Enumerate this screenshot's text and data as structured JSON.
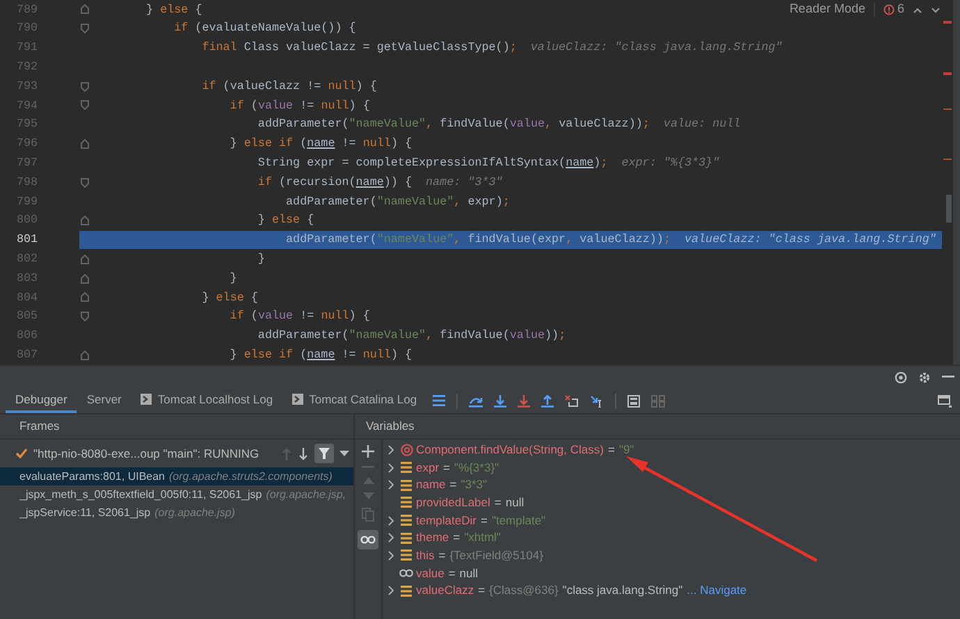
{
  "editor": {
    "reader_mode": "Reader Mode",
    "problems_count": "6",
    "lines": [
      {
        "number": "789",
        "fold": {
          "kind": "close"
        },
        "selected": false,
        "tokens": [
          {
            "t": "} ",
            "kind": "text"
          },
          {
            "t": "else",
            "kind": "keyword"
          },
          {
            "t": " {",
            "kind": "text"
          }
        ]
      },
      {
        "number": "790",
        "fold": {
          "kind": "open"
        },
        "selected": false,
        "tokens": [
          {
            "t": "    if",
            "kind": "keyword"
          },
          {
            "t": " (evaluateNameValue()) {",
            "kind": "text"
          }
        ]
      },
      {
        "number": "791",
        "selected": false,
        "tokens": [
          {
            "t": "        final",
            "kind": "keyword"
          },
          {
            "t": " Class valueClazz = getValueClassType()",
            "kind": "text"
          },
          {
            "t": ";",
            "kind": "keyword"
          }
        ],
        "hint": "valueClazz: \"class java.lang.String\""
      },
      {
        "number": "792",
        "selected": false
      },
      {
        "number": "793",
        "fold": {
          "kind": "open"
        },
        "selected": false,
        "tokens": [
          {
            "t": "        if",
            "kind": "keyword"
          },
          {
            "t": " (valueClazz != ",
            "kind": "text"
          },
          {
            "t": "null",
            "kind": "keyword"
          },
          {
            "t": ") {",
            "kind": "text"
          }
        ]
      },
      {
        "number": "794",
        "fold": {
          "kind": "open"
        },
        "selected": false,
        "tokens": [
          {
            "t": "            if",
            "kind": "keyword"
          },
          {
            "t": " (",
            "kind": "text"
          },
          {
            "t": "value",
            "kind": "field"
          },
          {
            "t": " != ",
            "kind": "text"
          },
          {
            "t": "null",
            "kind": "keyword"
          },
          {
            "t": ") {",
            "kind": "text"
          }
        ]
      },
      {
        "number": "795",
        "selected": false,
        "tokens": [
          {
            "t": "                addParameter(",
            "kind": "text"
          },
          {
            "t": "\"nameValue\"",
            "kind": "string"
          },
          {
            "t": ",",
            "kind": "keyword"
          },
          {
            "t": " findValue(",
            "kind": "text"
          },
          {
            "t": "value",
            "kind": "field"
          },
          {
            "t": ",",
            "kind": "keyword"
          },
          {
            "t": " valueClazz))",
            "kind": "text"
          },
          {
            "t": ";",
            "kind": "keyword"
          }
        ],
        "hint": "value: null"
      },
      {
        "number": "796",
        "fold": {
          "kind": "close"
        },
        "selected": false,
        "tokens": [
          {
            "t": "            } ",
            "kind": "text"
          },
          {
            "t": "else if",
            "kind": "keyword"
          },
          {
            "t": " (",
            "kind": "text"
          },
          {
            "t": "name",
            "kind": "param"
          },
          {
            "t": " != ",
            "kind": "text"
          },
          {
            "t": "null",
            "kind": "keyword"
          },
          {
            "t": ") {",
            "kind": "text"
          }
        ]
      },
      {
        "number": "797",
        "selected": false,
        "tokens": [
          {
            "t": "                String expr = completeExpressionIfAltSyntax(",
            "kind": "text"
          },
          {
            "t": "name",
            "kind": "param"
          },
          {
            "t": ")",
            "kind": "text"
          },
          {
            "t": ";",
            "kind": "keyword"
          }
        ],
        "hint": "expr: \"%{3*3}\""
      },
      {
        "number": "798",
        "fold": {
          "kind": "open"
        },
        "selected": false,
        "tokens": [
          {
            "t": "                if",
            "kind": "keyword"
          },
          {
            "t": " (recursion(",
            "kind": "text"
          },
          {
            "t": "name",
            "kind": "param"
          },
          {
            "t": ")) {",
            "kind": "text"
          }
        ],
        "hint": "name: \"3*3\""
      },
      {
        "number": "799",
        "selected": false,
        "tokens": [
          {
            "t": "                    addParameter(",
            "kind": "text"
          },
          {
            "t": "\"nameValue\"",
            "kind": "string"
          },
          {
            "t": ",",
            "kind": "keyword"
          },
          {
            "t": " expr)",
            "kind": "text"
          },
          {
            "t": ";",
            "kind": "keyword"
          }
        ]
      },
      {
        "number": "800",
        "fold": {
          "kind": "close"
        },
        "selected": false,
        "tokens": [
          {
            "t": "                } ",
            "kind": "text"
          },
          {
            "t": "else",
            "kind": "keyword"
          },
          {
            "t": " {",
            "kind": "text"
          }
        ]
      },
      {
        "number": "801",
        "selected": true,
        "tokens": [
          {
            "t": "                    addParameter(",
            "kind": "text"
          },
          {
            "t": "\"nameValue\"",
            "kind": "string"
          },
          {
            "t": ",",
            "kind": "keyword"
          },
          {
            "t": " findValue(expr",
            "kind": "text"
          },
          {
            "t": ",",
            "kind": "keyword"
          },
          {
            "t": " valueClazz))",
            "kind": "text"
          },
          {
            "t": ";",
            "kind": "keyword"
          }
        ],
        "hint": "valueClazz: \"class java.lang.String\""
      },
      {
        "number": "802",
        "fold": {
          "kind": "close"
        },
        "selected": false,
        "tokens": [
          {
            "t": "                }",
            "kind": "text"
          }
        ]
      },
      {
        "number": "803",
        "fold": {
          "kind": "close"
        },
        "selected": false,
        "tokens": [
          {
            "t": "            }",
            "kind": "text"
          }
        ]
      },
      {
        "number": "804",
        "fold": {
          "kind": "close"
        },
        "selected": false,
        "tokens": [
          {
            "t": "        } ",
            "kind": "text"
          },
          {
            "t": "else",
            "kind": "keyword"
          },
          {
            "t": " {",
            "kind": "text"
          }
        ]
      },
      {
        "number": "805",
        "fold": {
          "kind": "open"
        },
        "selected": false,
        "tokens": [
          {
            "t": "            if",
            "kind": "keyword"
          },
          {
            "t": " (",
            "kind": "text"
          },
          {
            "t": "value",
            "kind": "field"
          },
          {
            "t": " != ",
            "kind": "text"
          },
          {
            "t": "null",
            "kind": "keyword"
          },
          {
            "t": ") {",
            "kind": "text"
          }
        ]
      },
      {
        "number": "806",
        "selected": false,
        "tokens": [
          {
            "t": "                addParameter(",
            "kind": "text"
          },
          {
            "t": "\"nameValue\"",
            "kind": "string"
          },
          {
            "t": ",",
            "kind": "keyword"
          },
          {
            "t": " findValue(",
            "kind": "text"
          },
          {
            "t": "value",
            "kind": "field"
          },
          {
            "t": "))",
            "kind": "text"
          },
          {
            "t": ";",
            "kind": "keyword"
          }
        ]
      },
      {
        "number": "807",
        "fold": {
          "kind": "close"
        },
        "selected": false,
        "tokens": [
          {
            "t": "            } ",
            "kind": "text"
          },
          {
            "t": "else if",
            "kind": "keyword"
          },
          {
            "t": " (",
            "kind": "text"
          },
          {
            "t": "name",
            "kind": "param"
          },
          {
            "t": " != ",
            "kind": "text"
          },
          {
            "t": "null",
            "kind": "keyword"
          },
          {
            "t": ") {",
            "kind": "text"
          }
        ]
      }
    ]
  },
  "debugger": {
    "tabs": [
      {
        "label": "Debugger",
        "selected": true,
        "icon": false
      },
      {
        "label": "Server",
        "selected": false,
        "icon": false
      },
      {
        "label": "Tomcat Localhost Log",
        "selected": false,
        "icon": true
      },
      {
        "label": "Tomcat Catalina Log",
        "selected": false,
        "icon": true
      }
    ],
    "frames_header": "Frames",
    "variables_header": "Variables",
    "thread": "\"http-nio-8080-exe...oup \"main\": RUNNING",
    "frames": [
      {
        "method": "evaluateParams:801, UIBean",
        "package": "(org.apache.struts2.components)",
        "selected": true
      },
      {
        "method": "_jspx_meth_s_005ftextfield_005f0:11, S2061_jsp",
        "package": "(org.apache.jsp,",
        "selected": false
      },
      {
        "method": "_jspService:11, S2061_jsp",
        "package": "(org.apache.jsp)",
        "selected": false
      }
    ],
    "variables": [
      {
        "expandable": true,
        "kind": "method",
        "name": "Component.findValue(String, Class)",
        "op": "=",
        "value": {
          "text": "\"9\"",
          "kind": "string"
        }
      },
      {
        "expandable": true,
        "kind": "field",
        "name": "expr",
        "op": "=",
        "value": {
          "text": "\"%{3*3}\"",
          "kind": "string"
        }
      },
      {
        "expandable": true,
        "kind": "field",
        "name": "name",
        "op": "=",
        "value": {
          "text": "\"3*3\"",
          "kind": "string"
        }
      },
      {
        "expandable": false,
        "kind": "field",
        "name": "providedLabel",
        "op": "=",
        "value": {
          "text": "null",
          "kind": "plain"
        }
      },
      {
        "expandable": true,
        "kind": "field",
        "name": "templateDir",
        "op": "=",
        "value": {
          "text": "\"template\"",
          "kind": "string"
        }
      },
      {
        "expandable": true,
        "kind": "field",
        "name": "theme",
        "op": "=",
        "value": {
          "text": "\"xhtml\"",
          "kind": "string"
        }
      },
      {
        "expandable": true,
        "kind": "field",
        "name": "this",
        "op": "=",
        "value": {
          "text": "{TextField@5104}",
          "kind": "object"
        }
      },
      {
        "expandable": false,
        "kind": "watch",
        "name": "value",
        "op": "=",
        "value": {
          "text": "null",
          "kind": "plain"
        }
      },
      {
        "expandable": true,
        "kind": "field",
        "name": "valueClazz",
        "op": "=",
        "value": {
          "text": "{Class@636}",
          "kind": "object"
        },
        "detail": "\"class java.lang.String\"",
        "link": "... Navigate"
      }
    ]
  }
}
